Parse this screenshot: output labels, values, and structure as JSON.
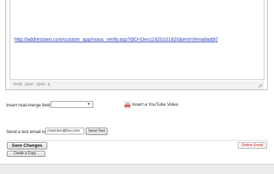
{
  "editor": {
    "link_text": "http://addresstwo.com/custom_app/mass_verify.asp?dID=Dev11920101820&eml=[emailaddr]",
    "path": [
      "body",
      "span",
      "span",
      "p"
    ]
  },
  "merge_field": {
    "label": "Insert mail-merge field:",
    "selected": ""
  },
  "youtube": {
    "icon_text": "You Tube",
    "label": "Insert a YouTube Video"
  },
  "test_email": {
    "label": "Send a test email to:",
    "value": "chad.live@live.com",
    "send_label": "Send Test"
  },
  "actions": {
    "save_label": "Save Changes",
    "copy_label": "Create a Copy...",
    "delete_label": "Delete Email"
  },
  "colors": {
    "link": "#2b44b8",
    "delete": "#cc2222",
    "youtube_red": "#cc1f1f"
  }
}
